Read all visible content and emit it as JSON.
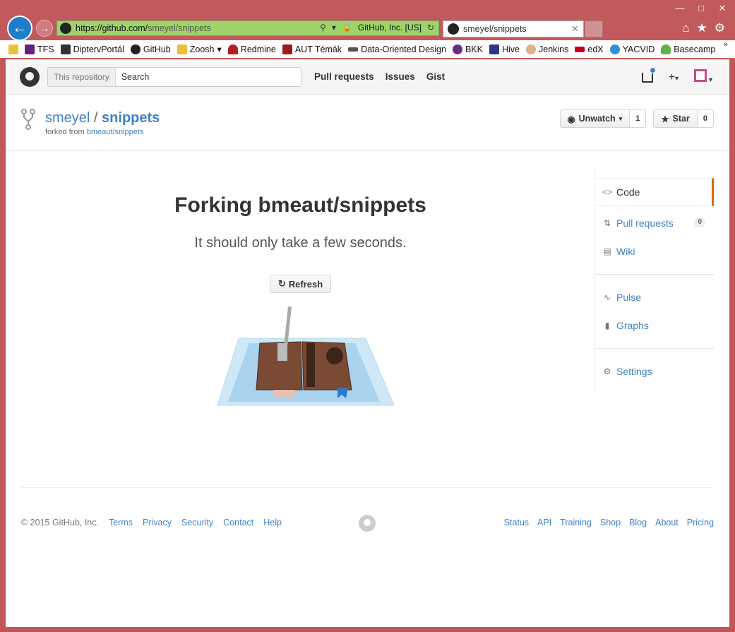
{
  "browser": {
    "url_base": "https://github.com/",
    "url_path": "smeyel/snippets",
    "cert_label": "GitHub, Inc. [US]",
    "tab_title": "smeyel/snippets",
    "favorites": [
      "TFS",
      "DiptervPortál",
      "GitHub",
      "Zoosh",
      "Redmine",
      "AUT Témák",
      "Data-Oriented Design",
      "BKK",
      "Hive",
      "Jenkins",
      "edX",
      "YACVID",
      "Basecamp"
    ]
  },
  "header": {
    "search_scope": "This repository",
    "search_placeholder": "Search",
    "nav": [
      "Pull requests",
      "Issues",
      "Gist"
    ]
  },
  "repo": {
    "owner": "smeyel",
    "separator": "/",
    "name": "snippets",
    "forked_from_prefix": "forked from",
    "forked_from": "bmeaut/snippets",
    "unwatch_label": "Unwatch",
    "watch_count": "1",
    "star_label": "Star",
    "star_count": "0"
  },
  "main": {
    "title": "Forking bmeaut/snippets",
    "subtitle": "It should only take a few seconds.",
    "refresh_label": "Refresh"
  },
  "sidebar": {
    "code": "Code",
    "pull_requests": "Pull requests",
    "pull_requests_count": "0",
    "wiki": "Wiki",
    "pulse": "Pulse",
    "graphs": "Graphs",
    "settings": "Settings"
  },
  "footer": {
    "copyright": "© 2015 GitHub, Inc.",
    "left_links": [
      "Terms",
      "Privacy",
      "Security",
      "Contact",
      "Help"
    ],
    "right_links": [
      "Status",
      "API",
      "Training",
      "Shop",
      "Blog",
      "About",
      "Pricing"
    ]
  },
  "colors": {
    "link": "#4183c4",
    "selected_accent": "#d26911",
    "address_bar": "#9ed46a",
    "browser_frame": "#c05a5c"
  }
}
